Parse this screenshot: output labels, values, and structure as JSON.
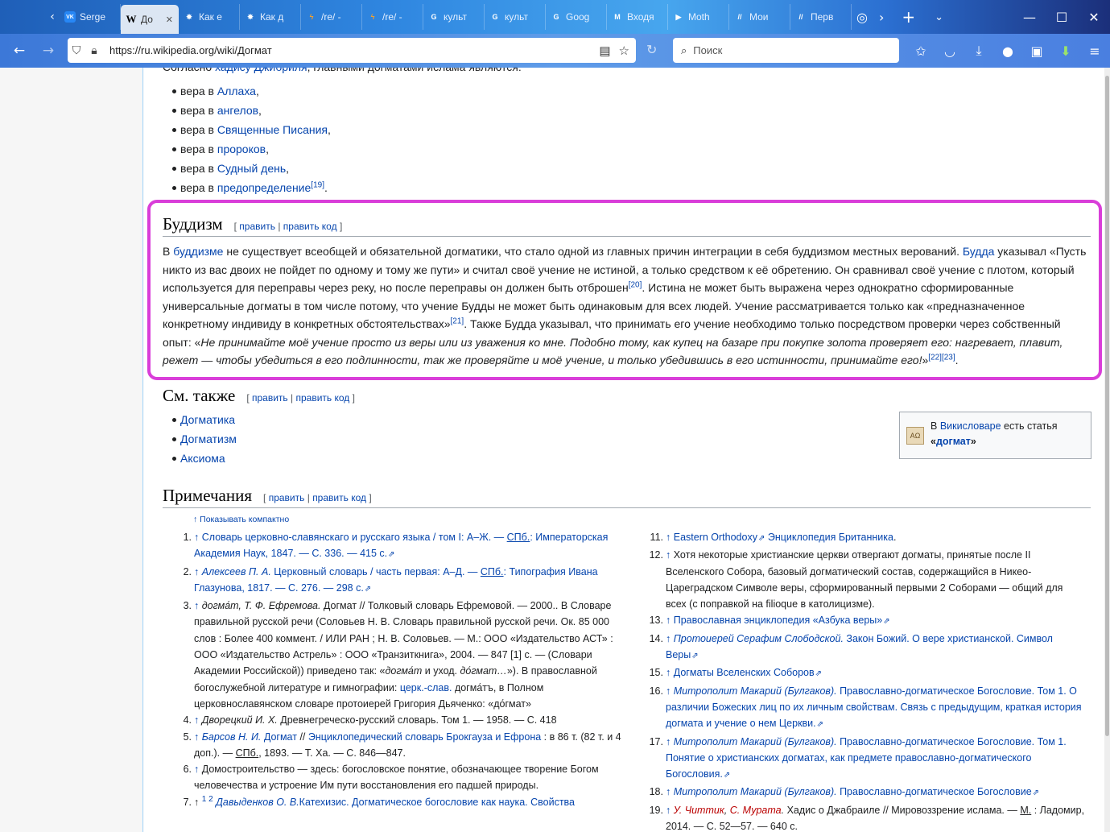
{
  "browser": {
    "tabs": [
      {
        "icon": "vk-icon",
        "label": "Serge",
        "fav": "VK",
        "favcolor": "#2787f5"
      },
      {
        "icon": "wikipedia-icon",
        "label": "До",
        "fav": "W",
        "favcolor": "#ffffff",
        "active": true
      },
      {
        "icon": "star-icon",
        "label": "Как е",
        "fav": "✸",
        "favcolor": "#ffffff"
      },
      {
        "icon": "star-icon",
        "label": "Как д",
        "fav": "✸",
        "favcolor": "#ffffff"
      },
      {
        "icon": "bolt-icon",
        "label": "/re/ -",
        "fav": "ϟ",
        "favcolor": "#f0a030"
      },
      {
        "icon": "bolt-icon",
        "label": "/re/ -",
        "fav": "ϟ",
        "favcolor": "#f0a030"
      },
      {
        "icon": "google-icon",
        "label": "культ",
        "fav": "G",
        "favcolor": "#ffffff"
      },
      {
        "icon": "google-icon",
        "label": "культ",
        "fav": "G",
        "favcolor": "#ffffff"
      },
      {
        "icon": "google-icon",
        "label": "Goog",
        "fav": "G",
        "favcolor": "#ffffff"
      },
      {
        "icon": "gmail-icon",
        "label": "Входя",
        "fav": "M",
        "favcolor": "#ffffff"
      },
      {
        "icon": "play-icon",
        "label": "Moth",
        "fav": "▶",
        "favcolor": "#ffffff"
      },
      {
        "icon": "slash-icon",
        "label": "Мои",
        "fav": "//",
        "favcolor": "#ffffff"
      },
      {
        "icon": "slash-icon",
        "label": "Перв",
        "fav": "//",
        "favcolor": "#ffffff"
      }
    ],
    "url": "https://ru.wikipedia.org/wiki/Догмат",
    "search_placeholder": "Поиск"
  },
  "islam_intro": "Согласно хадису Джибриля, главными догматами ислама являются:",
  "islam_list": [
    {
      "prefix": "вера в ",
      "link": "Аллаха",
      "suffix": ","
    },
    {
      "prefix": "вера в ",
      "link": "ангелов",
      "suffix": ","
    },
    {
      "prefix": "вера в ",
      "link": "Священные Писания",
      "suffix": ","
    },
    {
      "prefix": "вера в ",
      "link": "пророков",
      "suffix": ","
    },
    {
      "prefix": "вера в ",
      "link": "Судный день",
      "suffix": ","
    },
    {
      "prefix": "вера в ",
      "link": "предопределение",
      "sup": "[19]",
      "suffix": "."
    }
  ],
  "edit": {
    "open": "[",
    "edit": "править",
    "sep": "|",
    "edit_code": "править код",
    "close": "]"
  },
  "buddhism": {
    "title": "Буддизм",
    "p1": "В ",
    "l1": "буддизме",
    "p2": " не существует всеобщей и обязательной догматики, что стало одной из главных причин интеграции в себя буддизмом местных верований. ",
    "l2": "Будда",
    "p3": " указывал «Пусть никто из вас двоих не пойдет по одному и тому же пути» и считал своё учение не истиной, а только средством к её обретению. Он сравнивал своё учение с плотом, который используется для переправы через реку, но после переправы он должен быть отброшен",
    "s1": "[20]",
    "p4": ". Истина не может быть выражена через однократно сформированные универсальные догматы в том числе потому, что учение Будды не может быть одинаковым для всех людей. Учение рассматривается только как «предназначенное конкретному индивиду в конкретных обстоятельствах»",
    "s2": "[21]",
    "p5": ". Также Будда указывал, что принимать его учение необходимо только посредством проверки через собственный опыт: «",
    "quote": "Не принимайте моё учение просто из веры или из уважения ко мне. Подобно тому, как купец на базаре при покупке золота проверяет его: нагревает, плавит, режет — чтобы убедиться в его подлинности, так же проверяйте и моё учение, и только убедившись в его истинности, принимайте его!",
    "p6": "»",
    "s3": "[22]",
    "s4": "[23]",
    "p7": "."
  },
  "see_also": {
    "title": "См. также",
    "items": [
      "Догматика",
      "Догматизм",
      "Аксиома"
    ],
    "wiktionary": {
      "pre": "В ",
      "link": "Викисловаре",
      "mid": " есть статья",
      "quote_open": "«",
      "word": "догмат",
      "quote_close": "»"
    }
  },
  "notes": {
    "title": "Примечания",
    "compact": "↑ Показывать компактно"
  }
}
